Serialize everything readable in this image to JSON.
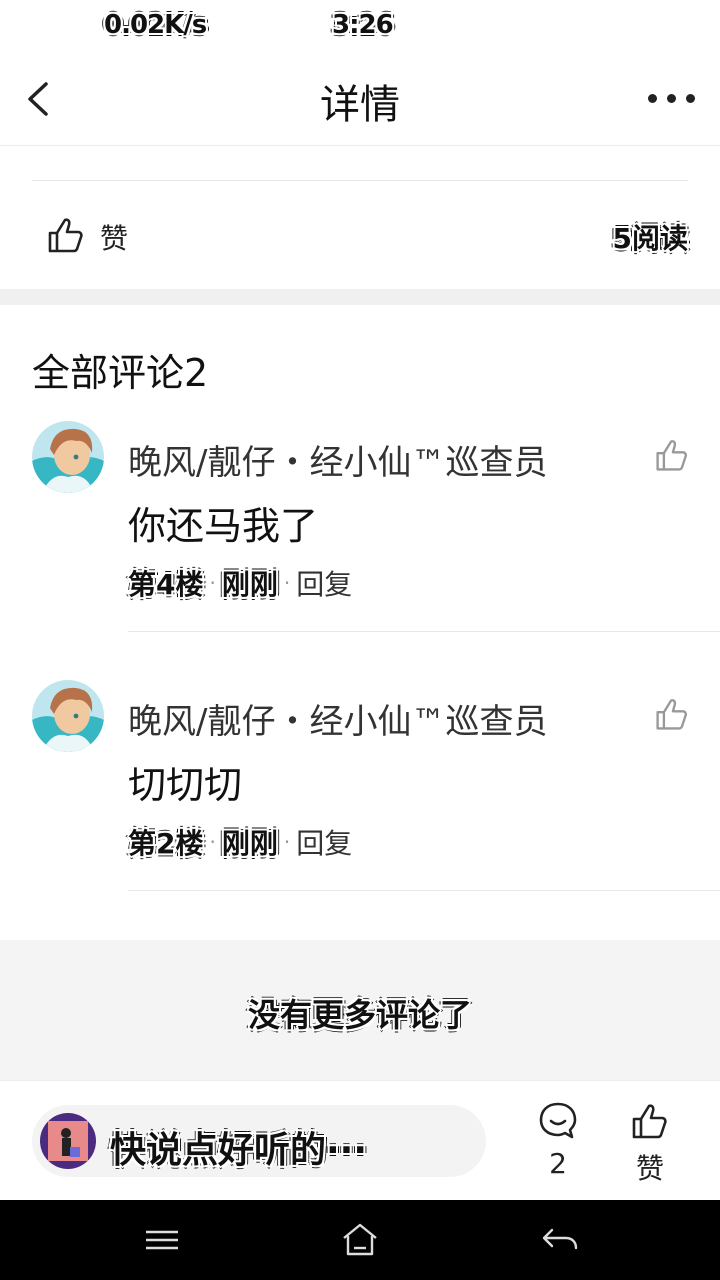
{
  "status_bar": {
    "network_speed": "0.02K/s",
    "time": "3:26"
  },
  "header": {
    "title": "详情",
    "back_icon": "chevron-left-icon",
    "more_icon": "more-horizontal-icon"
  },
  "post": {
    "like_label": "赞",
    "read_count": "5阅读"
  },
  "comments_section": {
    "title": "全部评论2",
    "comments": [
      {
        "author": "晚风/靓仔・经小仙™巡查员",
        "text": "你还马我了",
        "floor": "第4楼",
        "time": "刚刚",
        "reply_label": "回复"
      },
      {
        "author": "晚风/靓仔・经小仙™巡查员",
        "text": "切切切",
        "floor": "第2楼",
        "time": "刚刚",
        "reply_label": "回复"
      }
    ],
    "no_more": "没有更多评论了"
  },
  "bottom_bar": {
    "placeholder": "快说点好听的···",
    "comment_count": "2",
    "like_label": "赞"
  },
  "colors": {
    "divider": "#e8e8e8",
    "band": "#f0f0f0",
    "nav": "#000000"
  }
}
